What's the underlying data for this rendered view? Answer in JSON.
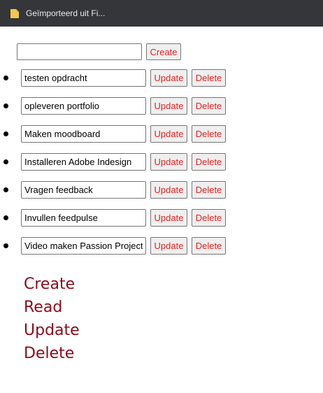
{
  "bookmarks_bar": {
    "folder_label": "Geïmporteerd uit Fi..."
  },
  "create_form": {
    "input_value": "",
    "button_label": "Create"
  },
  "todos": [
    {
      "text": "testen opdracht",
      "update_label": "Update",
      "delete_label": "Delete"
    },
    {
      "text": "opleveren portfolio",
      "update_label": "Update",
      "delete_label": "Delete"
    },
    {
      "text": "Maken moodboard",
      "update_label": "Update",
      "delete_label": "Delete"
    },
    {
      "text": "Installeren Adobe Indesign",
      "update_label": "Update",
      "delete_label": "Delete"
    },
    {
      "text": "Vragen feedback",
      "update_label": "Update",
      "delete_label": "Delete"
    },
    {
      "text": "Invullen feedpulse",
      "update_label": "Update",
      "delete_label": "Delete"
    },
    {
      "text": "Video maken Passion Project",
      "update_label": "Update",
      "delete_label": "Delete"
    }
  ],
  "crud_words": [
    "Create",
    "Read",
    "Update",
    "Delete"
  ],
  "colors": {
    "button_text": "#e51f1f",
    "crud_text": "#8b0a1a",
    "bar_background": "#35363a",
    "folder_icon": "#f2c94c"
  },
  "icons": {
    "folder": "folder-icon"
  }
}
